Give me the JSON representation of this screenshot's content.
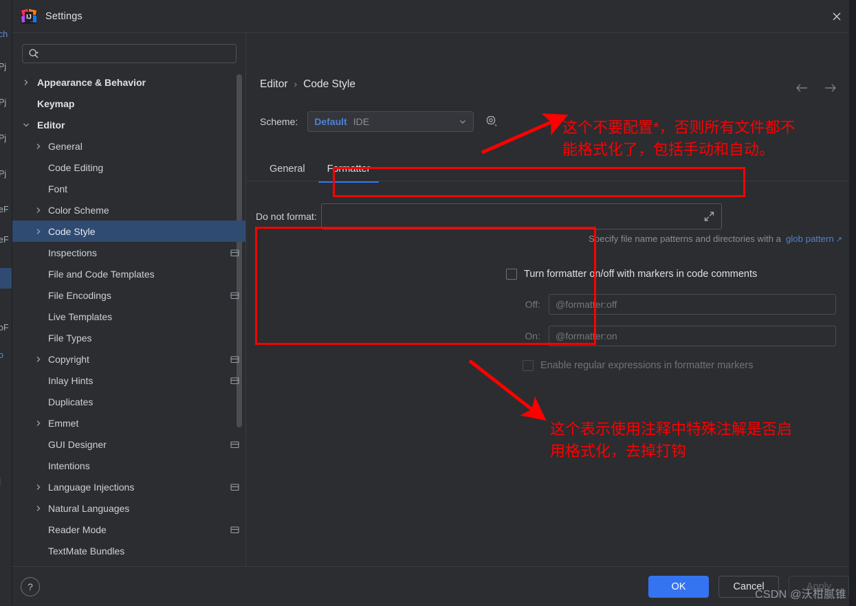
{
  "window": {
    "title": "Settings",
    "logo_icon": "intellij-idea-logo",
    "close_icon": "close-icon"
  },
  "sidebar": {
    "search": {
      "placeholder": "",
      "value": "",
      "icon": "search-icon",
      "dropdown_icon": "caret-down-icon"
    },
    "items": [
      {
        "label": "Appearance & Behavior",
        "indent": 0,
        "twisty": "chevron-right",
        "bold": true,
        "selected": false,
        "project_icon": false
      },
      {
        "label": "Keymap",
        "indent": 0,
        "twisty": "none",
        "bold": true,
        "selected": false,
        "project_icon": false
      },
      {
        "label": "Editor",
        "indent": 0,
        "twisty": "chevron-down",
        "bold": true,
        "selected": false,
        "project_icon": false
      },
      {
        "label": "General",
        "indent": 1,
        "twisty": "chevron-right",
        "bold": false,
        "selected": false,
        "project_icon": false
      },
      {
        "label": "Code Editing",
        "indent": 1,
        "twisty": "none",
        "bold": false,
        "selected": false,
        "project_icon": false
      },
      {
        "label": "Font",
        "indent": 1,
        "twisty": "none",
        "bold": false,
        "selected": false,
        "project_icon": false
      },
      {
        "label": "Color Scheme",
        "indent": 1,
        "twisty": "chevron-right",
        "bold": false,
        "selected": false,
        "project_icon": false
      },
      {
        "label": "Code Style",
        "indent": 1,
        "twisty": "chevron-right",
        "bold": false,
        "selected": true,
        "project_icon": false
      },
      {
        "label": "Inspections",
        "indent": 1,
        "twisty": "none",
        "bold": false,
        "selected": false,
        "project_icon": true
      },
      {
        "label": "File and Code Templates",
        "indent": 1,
        "twisty": "none",
        "bold": false,
        "selected": false,
        "project_icon": false
      },
      {
        "label": "File Encodings",
        "indent": 1,
        "twisty": "none",
        "bold": false,
        "selected": false,
        "project_icon": true
      },
      {
        "label": "Live Templates",
        "indent": 1,
        "twisty": "none",
        "bold": false,
        "selected": false,
        "project_icon": false
      },
      {
        "label": "File Types",
        "indent": 1,
        "twisty": "none",
        "bold": false,
        "selected": false,
        "project_icon": false
      },
      {
        "label": "Copyright",
        "indent": 1,
        "twisty": "chevron-right",
        "bold": false,
        "selected": false,
        "project_icon": true
      },
      {
        "label": "Inlay Hints",
        "indent": 1,
        "twisty": "none",
        "bold": false,
        "selected": false,
        "project_icon": true
      },
      {
        "label": "Duplicates",
        "indent": 1,
        "twisty": "none",
        "bold": false,
        "selected": false,
        "project_icon": false
      },
      {
        "label": "Emmet",
        "indent": 1,
        "twisty": "chevron-right",
        "bold": false,
        "selected": false,
        "project_icon": false
      },
      {
        "label": "GUI Designer",
        "indent": 1,
        "twisty": "none",
        "bold": false,
        "selected": false,
        "project_icon": true
      },
      {
        "label": "Intentions",
        "indent": 1,
        "twisty": "none",
        "bold": false,
        "selected": false,
        "project_icon": false
      },
      {
        "label": "Language Injections",
        "indent": 1,
        "twisty": "chevron-right",
        "bold": false,
        "selected": false,
        "project_icon": true
      },
      {
        "label": "Natural Languages",
        "indent": 1,
        "twisty": "chevron-right",
        "bold": false,
        "selected": false,
        "project_icon": false
      },
      {
        "label": "Reader Mode",
        "indent": 1,
        "twisty": "none",
        "bold": false,
        "selected": false,
        "project_icon": true
      },
      {
        "label": "TextMate Bundles",
        "indent": 1,
        "twisty": "none",
        "bold": false,
        "selected": false,
        "project_icon": false
      }
    ]
  },
  "main": {
    "breadcrumb": {
      "parent": "Editor",
      "separator": "›",
      "current": "Code Style"
    },
    "nav": {
      "back_icon": "arrow-left-icon",
      "forward_icon": "arrow-right-icon"
    },
    "scheme": {
      "label": "Scheme:",
      "value": "Default",
      "scope": "IDE",
      "chevron_icon": "chevron-down-icon",
      "gear_icon": "gear-icon",
      "accent_color": "#4d83d4"
    },
    "tabs": [
      {
        "label": "General",
        "active": false
      },
      {
        "label": "Formatter",
        "active": true
      }
    ],
    "do_not_format": {
      "label": "Do not format:",
      "value": "",
      "placeholder": "",
      "expand_icon": "expand-diagonal-icon"
    },
    "hint": {
      "text": "Specify file name patterns and directories with a",
      "link": "glob pattern",
      "link_icon": "external-link-icon"
    },
    "formatter_markers": {
      "enable_label": "Turn formatter on/off with markers in code comments",
      "enabled": false,
      "off_label": "Off:",
      "off_value": "",
      "off_placeholder": "@formatter:off",
      "on_label": "On:",
      "on_value": "",
      "on_placeholder": "@formatter:on",
      "regex_label": "Enable regular expressions in formatter markers",
      "regex_enabled": false
    }
  },
  "annotations": {
    "accent_color": "#fe0000",
    "note_1": "这个不要配置*，否则所有文件都不\n能格式化了，包括手动和自动。",
    "note_2": "这个表示使用注释中特殊注解是否启\n用格式化，去掉打钩"
  },
  "footer": {
    "help_icon": "question-mark-icon",
    "help_label": "?",
    "ok_label": "OK",
    "cancel_label": "Cancel",
    "apply_label": "Apply",
    "apply_disabled": true,
    "primary_color": "#3574f0"
  },
  "watermark": {
    "text": "CSDN @沃柑腻锥"
  },
  "background_ide": {
    "fragments": [
      "ch",
      "Pj",
      "Pj",
      "Pj",
      "Pj",
      "eF",
      "eF",
      "oF",
      "o"
    ]
  }
}
